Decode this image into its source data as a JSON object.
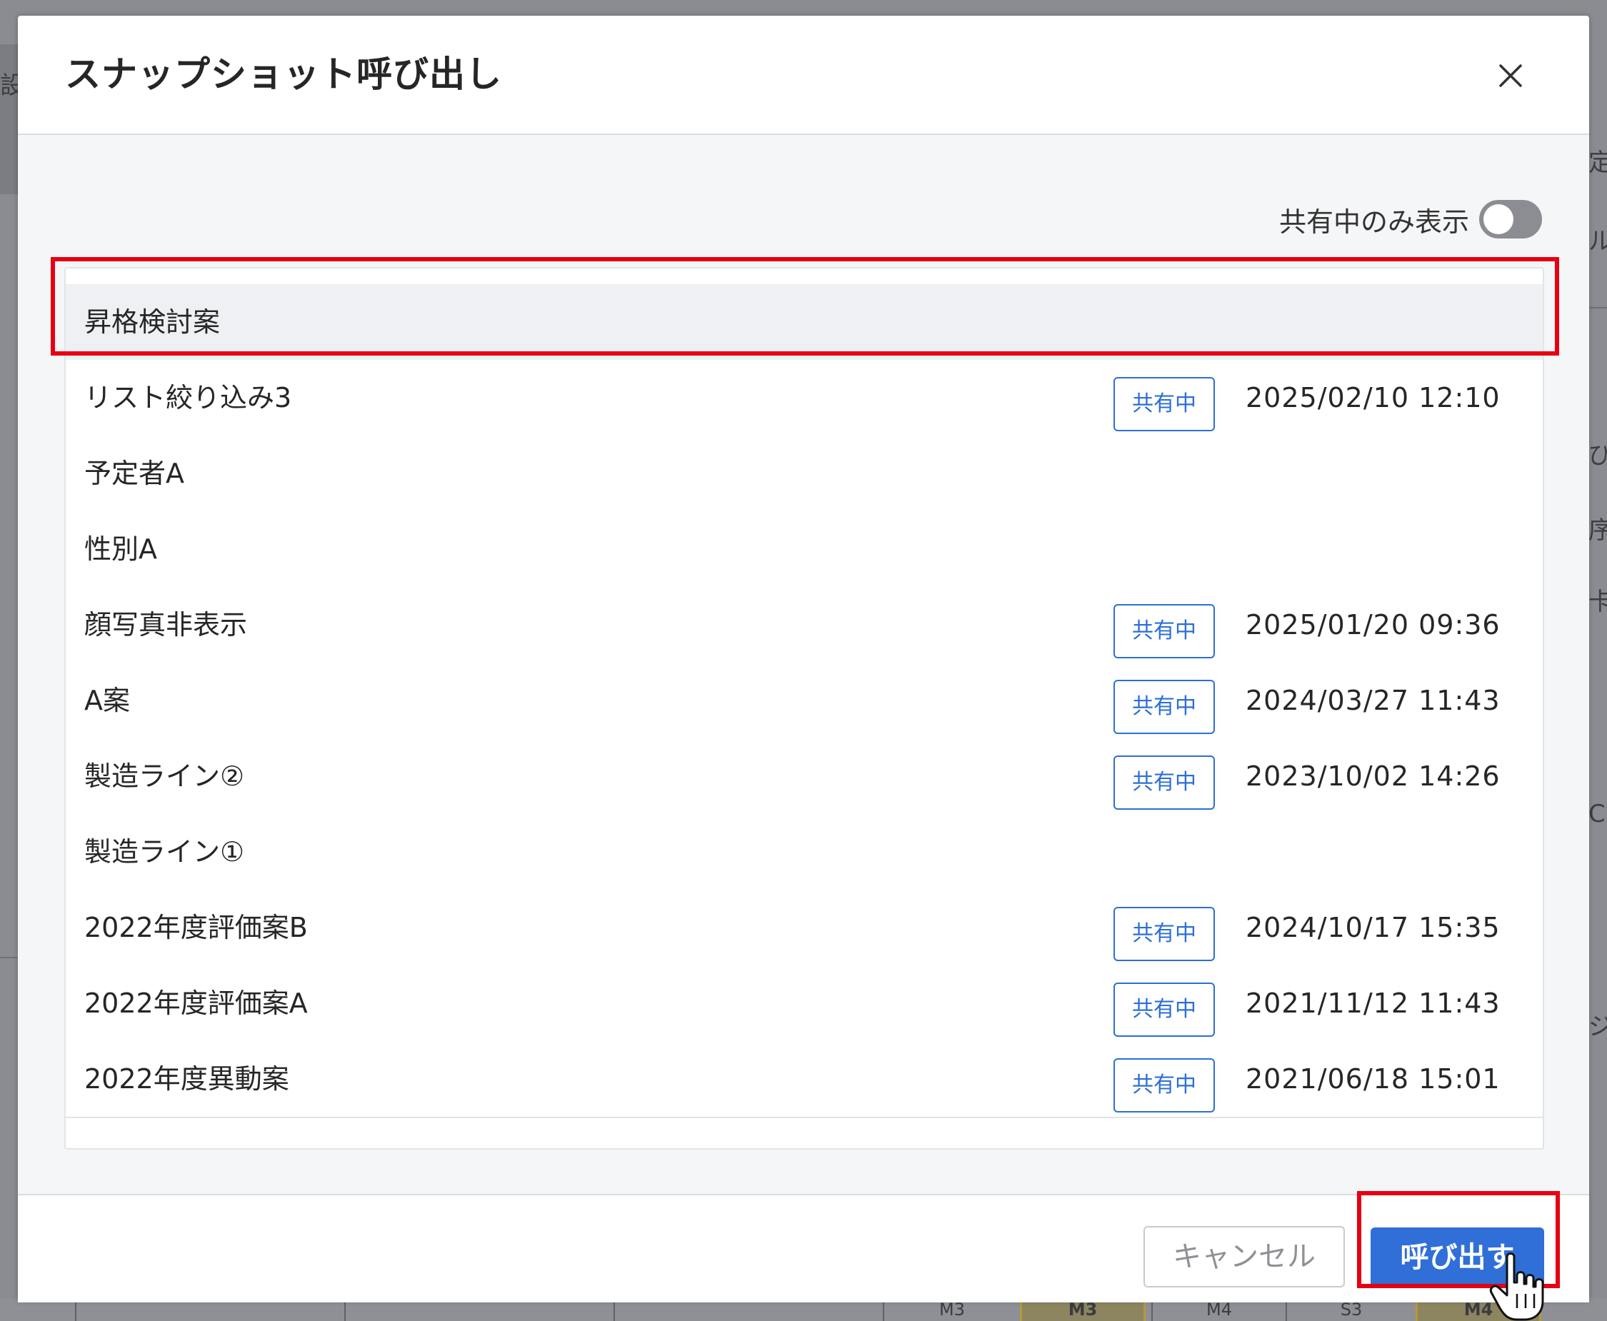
{
  "background": {
    "left_glyph": "設",
    "right_glyphs": [
      "定",
      "ル",
      "び",
      "序",
      "卡",
      "CE",
      "ジ"
    ],
    "bottom_columns": [
      "M3",
      "M3",
      "M4",
      "S3",
      "M4"
    ]
  },
  "dialog": {
    "title": "スナップショット呼び出し",
    "close_label": "×"
  },
  "filter": {
    "label": "共有中のみ表示",
    "toggle_on": false
  },
  "snapshots": [
    {
      "name": "昇格検討案",
      "shared_label": "",
      "date": "",
      "selected": true
    },
    {
      "name": "リスト絞り込み3",
      "shared_label": "共有中",
      "date": "2025/02/10 12:10",
      "selected": false
    },
    {
      "name": "予定者A",
      "shared_label": "",
      "date": "",
      "selected": false
    },
    {
      "name": "性別A",
      "shared_label": "",
      "date": "",
      "selected": false
    },
    {
      "name": "顔写真非表示",
      "shared_label": "共有中",
      "date": "2025/01/20 09:36",
      "selected": false
    },
    {
      "name": "A案",
      "shared_label": "共有中",
      "date": "2024/03/27 11:43",
      "selected": false
    },
    {
      "name": "製造ライン②",
      "shared_label": "共有中",
      "date": "2023/10/02 14:26",
      "selected": false
    },
    {
      "name": "製造ライン①",
      "shared_label": "",
      "date": "",
      "selected": false
    },
    {
      "name": "2022年度評価案B",
      "shared_label": "共有中",
      "date": "2024/10/17 15:35",
      "selected": false
    },
    {
      "name": "2022年度評価案A",
      "shared_label": "共有中",
      "date": "2021/11/12 11:43",
      "selected": false
    },
    {
      "name": "2022年度異動案",
      "shared_label": "共有中",
      "date": "2021/06/18 15:01",
      "selected": false
    }
  ],
  "footer": {
    "cancel_label": "キャンセル",
    "call_label": "呼び出す"
  },
  "colors": {
    "accent": "#2f6fd7",
    "highlight": "#e60012",
    "selected_row": "#eff0f3"
  }
}
